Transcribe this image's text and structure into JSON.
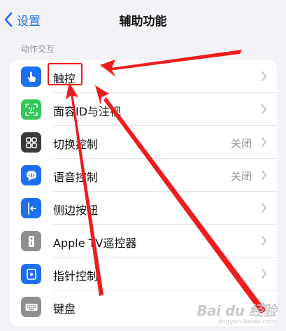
{
  "nav": {
    "back_label": "设置",
    "title": "辅助功能"
  },
  "section": {
    "header": "动作交互"
  },
  "rows": [
    {
      "label": "触控",
      "value": "",
      "icon": "hand-touch-icon",
      "color": "#1d6ff2"
    },
    {
      "label": "面容ID与注视",
      "value": "",
      "icon": "face-id-icon",
      "color": "#34c759"
    },
    {
      "label": "切换控制",
      "value": "关闭",
      "icon": "switch-control-icon",
      "color": "#3a3a3c"
    },
    {
      "label": "语音控制",
      "value": "关闭",
      "icon": "voice-control-icon",
      "color": "#1d6ff2"
    },
    {
      "label": "侧边按钮",
      "value": "",
      "icon": "side-button-icon",
      "color": "#1d6ff2"
    },
    {
      "label": "Apple TV遥控器",
      "value": "",
      "icon": "tv-remote-icon",
      "color": "#8e8e93"
    },
    {
      "label": "指针控制",
      "value": "",
      "icon": "pointer-control-icon",
      "color": "#1d6ff2"
    },
    {
      "label": "键盘",
      "value": "",
      "icon": "keyboard-icon",
      "color": "#8e8e93"
    }
  ],
  "annotation": {
    "highlight_color": "#ee1c1c"
  },
  "watermark": {
    "brand": "Bai du 经验",
    "url": "jingyan.baidu.com"
  }
}
